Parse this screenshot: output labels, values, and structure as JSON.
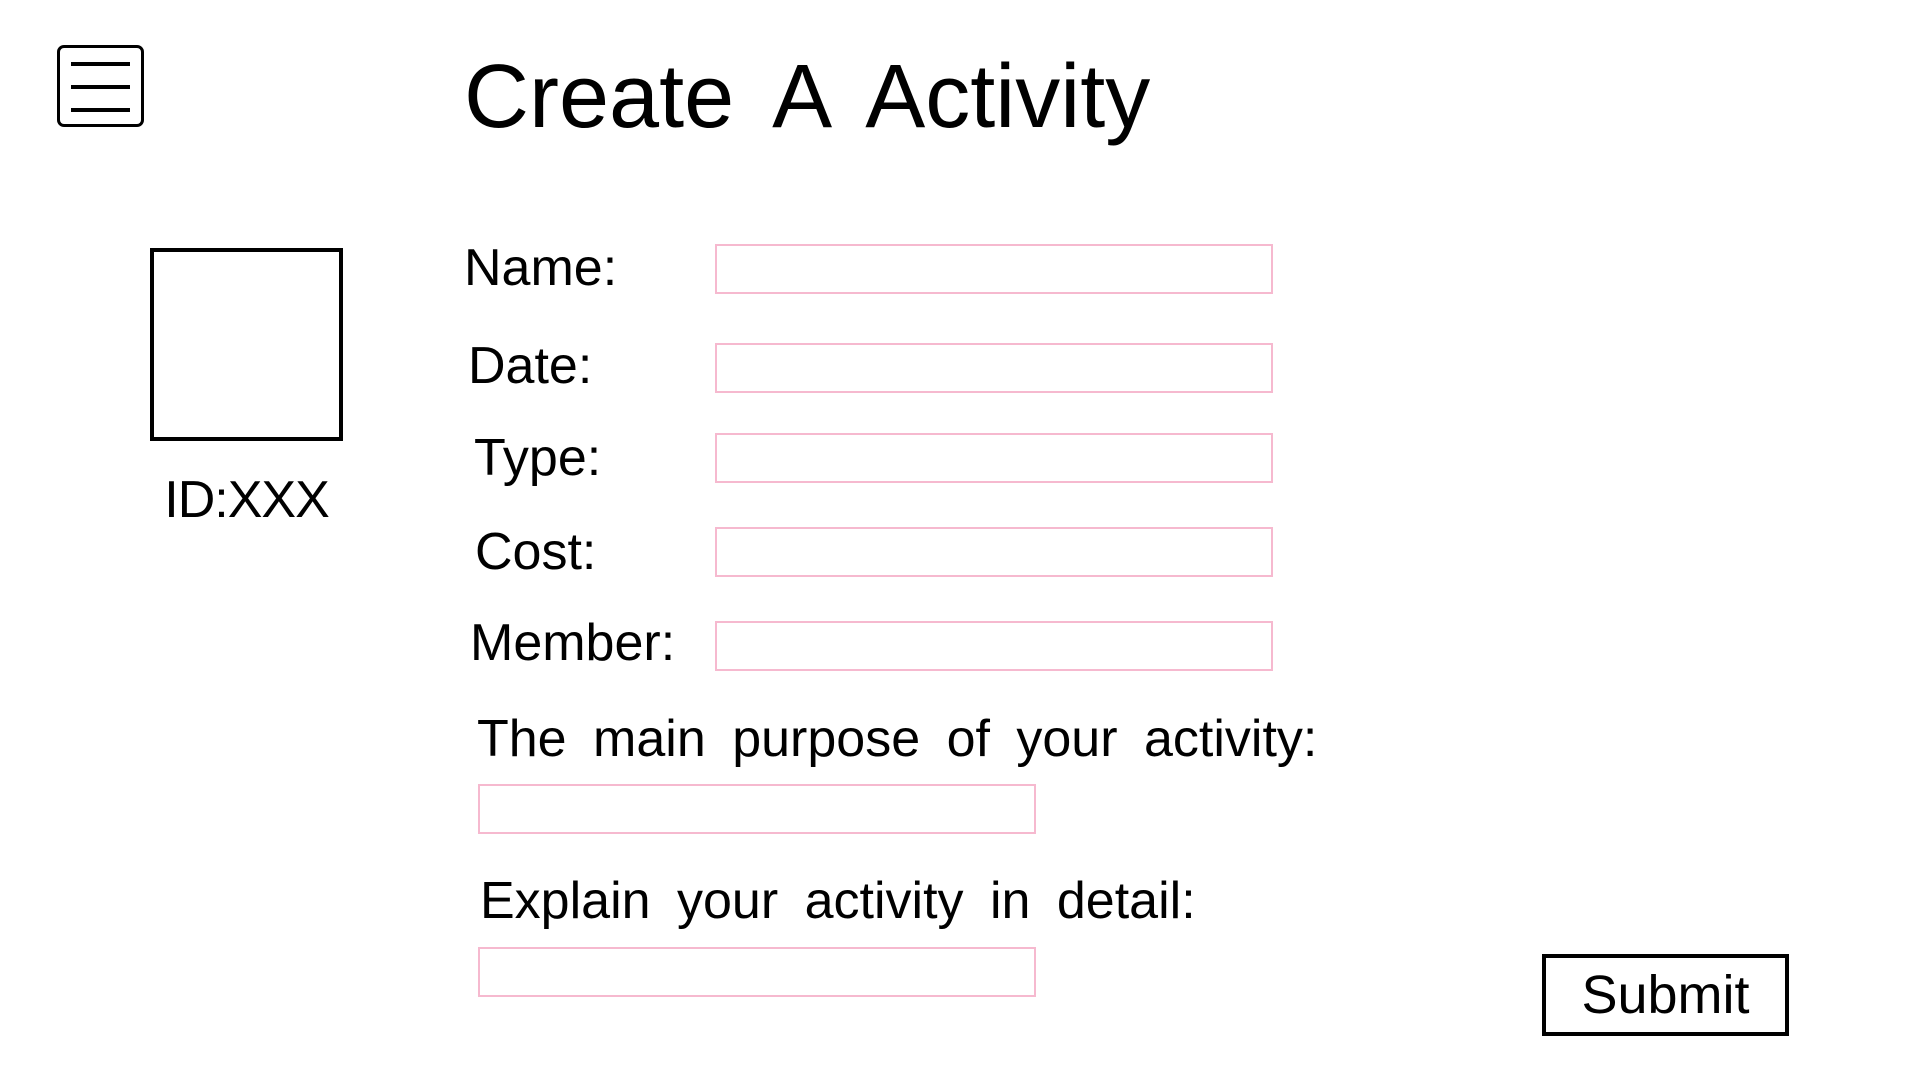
{
  "header": {
    "menu_icon": "hamburger-menu-icon",
    "title": "Create A Activity"
  },
  "profile": {
    "id_text": "ID:XXX"
  },
  "form": {
    "fields": [
      {
        "label": "Name:",
        "value": "",
        "placeholder": ""
      },
      {
        "label": "Date:",
        "value": "",
        "placeholder": ""
      },
      {
        "label": "Type:",
        "value": "",
        "placeholder": ""
      },
      {
        "label": "Cost:",
        "value": "",
        "placeholder": ""
      },
      {
        "label": "Member:",
        "value": "",
        "placeholder": ""
      }
    ],
    "purpose": {
      "label": "The main purpose of your activity:",
      "value": "",
      "placeholder": ""
    },
    "detail": {
      "label": "Explain your activity in detail:",
      "value": "",
      "placeholder": ""
    },
    "submit_label": "Submit"
  },
  "colors": {
    "input_border": "#f6b9cf",
    "outline": "#000000",
    "background": "#ffffff"
  }
}
